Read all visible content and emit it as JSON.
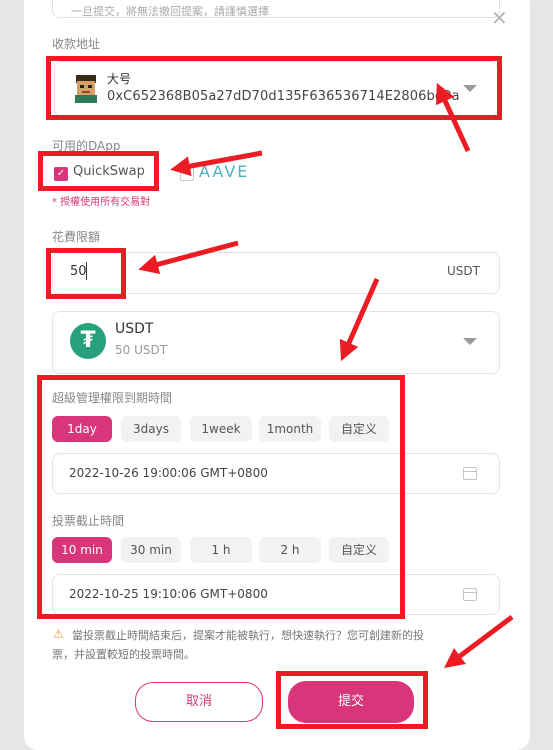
{
  "top_field": {
    "text": "一旦提交，將無法撤回提案，請謹慎選擇"
  },
  "address": {
    "label": "收款地址",
    "account_name": "大号",
    "value": "0xC652368B05a27dD70d135F636536714E2806bd9a"
  },
  "dapp": {
    "label": "可用的DApp",
    "options": [
      {
        "name": "QuickSwap",
        "checked": true
      },
      {
        "name": "AAVE",
        "checked": false
      }
    ],
    "note": "* 授權使用所有交易對"
  },
  "spend_limit": {
    "label": "花費限額",
    "value": "50",
    "unit": "USDT"
  },
  "token": {
    "symbol": "USDT",
    "balance": "50 USDT",
    "icon_glyph": "₮",
    "icon_color": "#26a17b"
  },
  "admin_expiry": {
    "label": "超級管理權限到期時間",
    "options": [
      "1day",
      "3days",
      "1week",
      "1month",
      "自定义"
    ],
    "selected": "1day",
    "datetime": "2022-10-26 19:00:06 GMT+0800"
  },
  "vote_deadline": {
    "label": "投票截止時間",
    "options": [
      "10 min",
      "30 min",
      "1 h",
      "2 h",
      "自定义"
    ],
    "selected": "10 min",
    "datetime": "2022-10-25 19:10:06 GMT+0800"
  },
  "warning": {
    "line1": "當投票截止時間結束后，提案才能被執行，想快速執行？您可創建新的投",
    "line2": "票，并設置較短的投票時間。"
  },
  "buttons": {
    "cancel": "取消",
    "submit": "提交"
  },
  "colors": {
    "accent": "#d8357a",
    "annotation": "#ec1c24"
  }
}
